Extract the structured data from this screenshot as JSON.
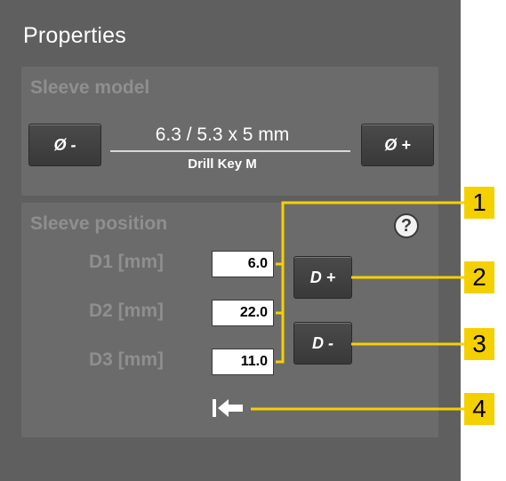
{
  "panel": {
    "title": "Properties"
  },
  "sleeve_model": {
    "title": "Sleeve model",
    "decrease_label": "Ø -",
    "increase_label": "Ø +",
    "size": "6.3 / 5.3 x 5 mm",
    "drill_key": "Drill Key M"
  },
  "sleeve_position": {
    "title": "Sleeve position",
    "help_label": "?",
    "fields": [
      {
        "label": "D1 [mm]",
        "value": "6.0"
      },
      {
        "label": "D2 [mm]",
        "value": "22.0"
      },
      {
        "label": "D3 [mm]",
        "value": "11.0"
      }
    ],
    "d_plus_label": "D +",
    "d_minus_label": "D -",
    "reset_icon": "arrow-to-left-icon"
  },
  "callouts": [
    "1",
    "2",
    "3",
    "4"
  ],
  "colors": {
    "panel_bg": "#5f5f5f",
    "group_bg": "#6b6b6b",
    "callout": "#f5d000"
  }
}
